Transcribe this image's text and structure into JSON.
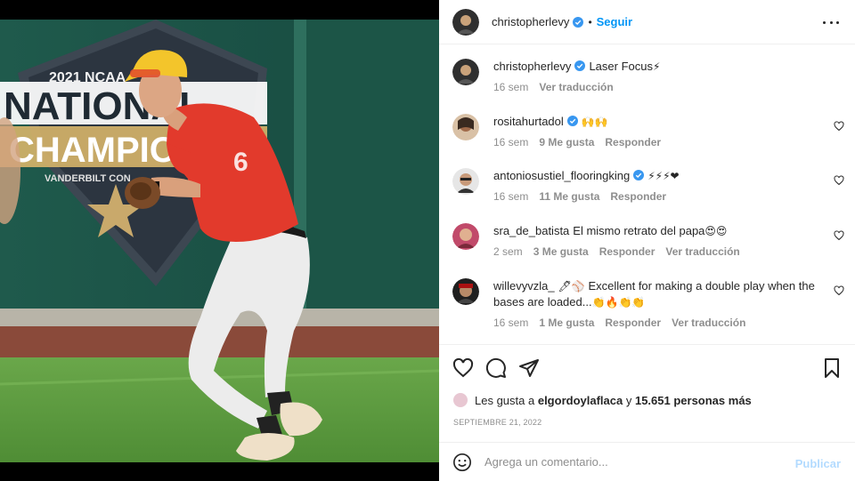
{
  "post": {
    "author": "christopherlevy",
    "follow_label": "Seguir",
    "separator": "•",
    "caption_user": "christopherlevy",
    "caption_text": "Laser Focus",
    "caption_emoji": "⚡",
    "caption_time": "16 sem",
    "caption_translate": "Ver traducción",
    "photo_text": {
      "line1": "2021 NCAA",
      "line2": "NATIONAL",
      "line3": "CHAMPIO",
      "line4": "VANDERBILT CON",
      "jersey": "6"
    }
  },
  "comments": [
    {
      "user": "rositahurtadol",
      "verified": true,
      "text": "",
      "emoji": "🙌🙌",
      "time": "16 sem",
      "likes": "9 Me gusta",
      "reply": "Responder",
      "translate": ""
    },
    {
      "user": "antoniosustiel_flooringking",
      "verified": true,
      "text": "",
      "emoji": "⚡⚡⚡❤",
      "time": "16 sem",
      "likes": "11 Me gusta",
      "reply": "Responder",
      "translate": ""
    },
    {
      "user": "sra_de_batista",
      "verified": false,
      "text": "El mismo retrato del papa",
      "emoji": "😍😍",
      "time": "2 sem",
      "likes": "3 Me gusta",
      "reply": "Responder",
      "translate": "Ver traducción"
    },
    {
      "user": "willevyvzla_",
      "verified": false,
      "text_prefix_emoji": "🖊⚾",
      "text": "Excellent for making a double play when the bases are loaded...",
      "emoji": "👏🔥👏👏",
      "time": "16 sem",
      "likes": "1 Me gusta",
      "reply": "Responder",
      "translate": "Ver traducción"
    }
  ],
  "likes": {
    "prefix": "Les gusta a",
    "user": "elgordoylaflaca",
    "and": "y",
    "count": "15.651 personas más"
  },
  "date": "SEPTIEMBRE 21, 2022",
  "add_comment": {
    "placeholder": "Agrega un comentario...",
    "publish_label": "Publicar"
  },
  "colors": {
    "accent": "#0095f6",
    "verified": "#3897f0",
    "muted": "#8e8e8e"
  }
}
